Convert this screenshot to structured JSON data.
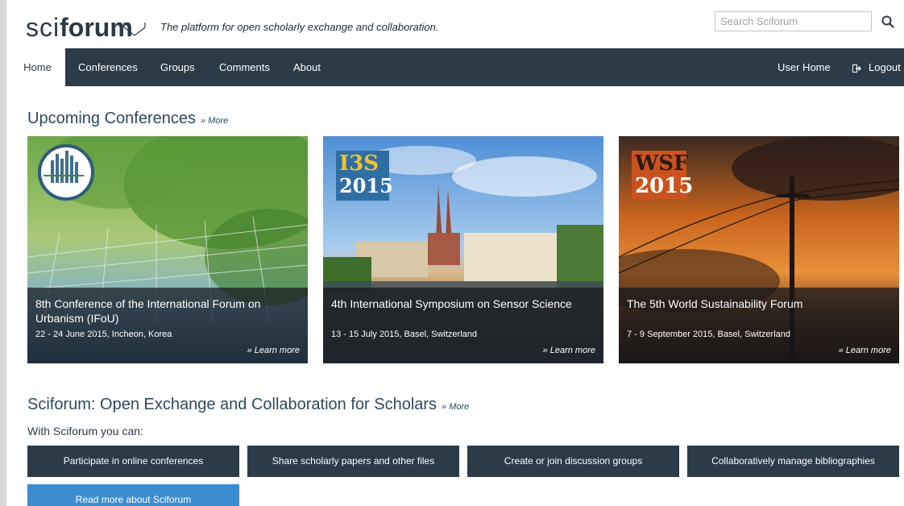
{
  "header": {
    "logo_light": "sci",
    "logo_bold": "forum",
    "tagline": "The platform for open scholarly exchange and collaboration.",
    "search_placeholder": "Search Sciforum"
  },
  "nav": {
    "items": [
      "Home",
      "Conferences",
      "Groups",
      "Comments",
      "About"
    ],
    "user_home": "User Home",
    "logout": "Logout"
  },
  "upcoming": {
    "title": "Upcoming Conferences",
    "more": "» More",
    "cards": [
      {
        "title": "8th Conference of the International Forum on Urbanism (IFoU)",
        "date": "22 - 24 June 2015, Incheon, Korea",
        "learn": "» Learn more"
      },
      {
        "badge_line1": "I3S",
        "badge_line2": "2015",
        "title": "4th International Symposium on Sensor Science",
        "date": "13 - 15 July 2015, Basel, Switzerland",
        "learn": "» Learn more"
      },
      {
        "badge_line1": "WSF",
        "badge_line2": "2015",
        "title": "The 5th World Sustainability Forum",
        "date": "7 - 9 September 2015, Basel, Switzerland",
        "learn": "» Learn more"
      }
    ]
  },
  "about": {
    "title": "Sciforum: Open Exchange and Collaboration for Scholars",
    "more": "» More",
    "intro": "With Sciforum you can:",
    "features": [
      "Participate in online conferences",
      "Share scholarly papers and other files",
      "Create or join discussion groups",
      "Collaboratively manage bibliographies"
    ],
    "read_more": "Read more about Sciforum"
  },
  "colors": {
    "nav_bg": "#2b3b47",
    "accent_blue": "#3b8dd0",
    "title_text": "#2e4a5c"
  }
}
